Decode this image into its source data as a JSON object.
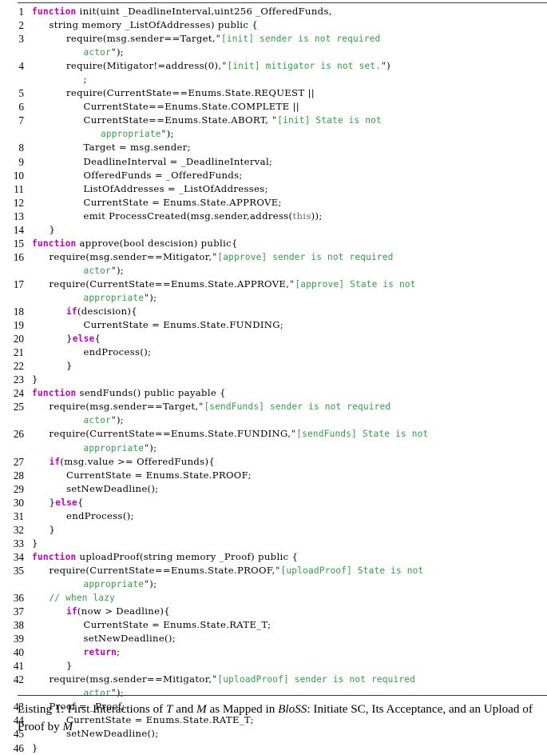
{
  "figure": {
    "type": "latex-code-listing",
    "language": "Solidity",
    "rules": {
      "color": "#3a3a3a"
    },
    "syntax_colors": {
      "keyword": "#bf00bf",
      "string": "#2f9e44",
      "comment": "#2f9e44",
      "identifier": "#000000",
      "builtin": "#6b6b6b",
      "background": "#ffffff"
    }
  },
  "caption": {
    "prefix": "Listing 1:",
    "text_part_1": " First Interactions of ",
    "em_1": "T",
    "text_part_2": " and ",
    "em_2": "M",
    "text_part_3": " as Mapped in ",
    "em_3": "BloSS",
    "text_part_4": ": Initiate SC, Its Acceptance, and an Upload of Proof by ",
    "em_4": "M",
    "full": "Listing 1: First Interactions of T and M as Mapped in BloSS: Initiate SC, Its Acceptance, and an Upload of Proof by M"
  },
  "code": {
    "line_numbers": [
      1,
      2,
      3,
      "",
      4,
      "",
      5,
      6,
      7,
      "",
      8,
      9,
      10,
      11,
      12,
      13,
      14,
      15,
      16,
      "",
      17,
      "",
      18,
      19,
      20,
      21,
      22,
      23,
      24,
      25,
      "",
      26,
      "",
      27,
      28,
      29,
      30,
      31,
      32,
      33,
      34,
      35,
      "",
      36,
      37,
      38,
      39,
      40,
      41,
      42,
      "",
      43,
      44,
      45,
      46
    ],
    "lines": [
      {
        "n": "1",
        "tokens": [
          {
            "t": "kw",
            "v": "function"
          },
          {
            "t": "id",
            "v": " init(uint _DeadlineInterval,uint256 _OfferedFunds,"
          }
        ],
        "indent": 0
      },
      {
        "n": "2",
        "tokens": [
          {
            "t": "id",
            "v": "string memory _ListOfAddresses) public {"
          }
        ],
        "indent": 1
      },
      {
        "n": "3",
        "tokens": [
          {
            "t": "id",
            "v": "require(msg.sender==Target,"
          },
          {
            "t": "qt",
            "v": "\""
          },
          {
            "t": "str",
            "v": "[init] sender is not required"
          }
        ],
        "indent": 2
      },
      {
        "n": "",
        "tokens": [
          {
            "t": "str",
            "v": "actor"
          },
          {
            "t": "qt",
            "v": "\""
          },
          {
            "t": "id",
            "v": ");"
          }
        ],
        "indent": 3
      },
      {
        "n": "4",
        "tokens": [
          {
            "t": "id",
            "v": "require(Mitigator!=address(0),"
          },
          {
            "t": "qt",
            "v": "\""
          },
          {
            "t": "str",
            "v": "[init] mitigator is not set."
          },
          {
            "t": "qt",
            "v": "\""
          },
          {
            "t": "id",
            "v": ")"
          }
        ],
        "indent": 2
      },
      {
        "n": "",
        "tokens": [
          {
            "t": "id",
            "v": ";"
          }
        ],
        "indent": 3
      },
      {
        "n": "5",
        "tokens": [
          {
            "t": "id",
            "v": "require(CurrentState==Enums.State.REQUEST ||"
          }
        ],
        "indent": 2
      },
      {
        "n": "6",
        "tokens": [
          {
            "t": "id",
            "v": "CurrentState==Enums.State.COMPLETE ||"
          }
        ],
        "indent": 3
      },
      {
        "n": "7",
        "tokens": [
          {
            "t": "id",
            "v": "CurrentState==Enums.State.ABORT, "
          },
          {
            "t": "qt",
            "v": "\""
          },
          {
            "t": "str",
            "v": "[init] State is not"
          }
        ],
        "indent": 3
      },
      {
        "n": "",
        "tokens": [
          {
            "t": "str",
            "v": "appropriate"
          },
          {
            "t": "qt",
            "v": "\""
          },
          {
            "t": "id",
            "v": ");"
          }
        ],
        "indent": 4
      },
      {
        "n": "8",
        "tokens": [
          {
            "t": "id",
            "v": "Target = msg.sender;"
          }
        ],
        "indent": 3
      },
      {
        "n": "9",
        "tokens": [
          {
            "t": "id",
            "v": "DeadlineInterval = _DeadlineInterval;"
          }
        ],
        "indent": 3
      },
      {
        "n": "10",
        "tokens": [
          {
            "t": "id",
            "v": "OfferedFunds = _OfferedFunds;"
          }
        ],
        "indent": 3
      },
      {
        "n": "11",
        "tokens": [
          {
            "t": "id",
            "v": "ListOfAddresses = _ListOfAddresses;"
          }
        ],
        "indent": 3
      },
      {
        "n": "12",
        "tokens": [
          {
            "t": "id",
            "v": "CurrentState = Enums.State.APPROVE;"
          }
        ],
        "indent": 3
      },
      {
        "n": "13",
        "tokens": [
          {
            "t": "id",
            "v": "emit ProcessCreated(msg.sender,address("
          },
          {
            "t": "gry",
            "v": "this"
          },
          {
            "t": "id",
            "v": "));"
          }
        ],
        "indent": 3
      },
      {
        "n": "14",
        "tokens": [
          {
            "t": "id",
            "v": "}"
          }
        ],
        "indent": 1
      },
      {
        "n": "15",
        "tokens": [
          {
            "t": "kw",
            "v": "function"
          },
          {
            "t": "id",
            "v": " approve(bool descision) public{"
          }
        ],
        "indent": 0
      },
      {
        "n": "16",
        "tokens": [
          {
            "t": "id",
            "v": "require(msg.sender==Mitigator,"
          },
          {
            "t": "qt",
            "v": "\""
          },
          {
            "t": "str",
            "v": "[approve] sender is not required"
          }
        ],
        "indent": 1
      },
      {
        "n": "",
        "tokens": [
          {
            "t": "str",
            "v": "actor"
          },
          {
            "t": "qt",
            "v": "\""
          },
          {
            "t": "id",
            "v": ");"
          }
        ],
        "indent": 3
      },
      {
        "n": "17",
        "tokens": [
          {
            "t": "id",
            "v": "require(CurrentState==Enums.State.APPROVE,"
          },
          {
            "t": "qt",
            "v": "\""
          },
          {
            "t": "str",
            "v": "[approve] State is not"
          }
        ],
        "indent": 1
      },
      {
        "n": "",
        "tokens": [
          {
            "t": "str",
            "v": "appropriate"
          },
          {
            "t": "qt",
            "v": "\""
          },
          {
            "t": "id",
            "v": ");"
          }
        ],
        "indent": 3
      },
      {
        "n": "18",
        "tokens": [
          {
            "t": "kw",
            "v": "if"
          },
          {
            "t": "id",
            "v": "(descision){"
          }
        ],
        "indent": 2
      },
      {
        "n": "19",
        "tokens": [
          {
            "t": "id",
            "v": "CurrentState = Enums.State.FUNDING;"
          }
        ],
        "indent": 3
      },
      {
        "n": "20",
        "tokens": [
          {
            "t": "id",
            "v": "}"
          },
          {
            "t": "kw",
            "v": "else"
          },
          {
            "t": "id",
            "v": "{"
          }
        ],
        "indent": 2
      },
      {
        "n": "21",
        "tokens": [
          {
            "t": "id",
            "v": "endProcess();"
          }
        ],
        "indent": 3
      },
      {
        "n": "22",
        "tokens": [
          {
            "t": "id",
            "v": "}"
          }
        ],
        "indent": 2
      },
      {
        "n": "23",
        "tokens": [
          {
            "t": "id",
            "v": "}"
          }
        ],
        "indent": 0
      },
      {
        "n": "24",
        "tokens": [
          {
            "t": "kw",
            "v": "function"
          },
          {
            "t": "id",
            "v": " sendFunds() public payable {"
          }
        ],
        "indent": 0
      },
      {
        "n": "25",
        "tokens": [
          {
            "t": "id",
            "v": "require(msg.sender==Target,"
          },
          {
            "t": "qt",
            "v": "\""
          },
          {
            "t": "str",
            "v": "[sendFunds] sender is not required"
          }
        ],
        "indent": 1
      },
      {
        "n": "",
        "tokens": [
          {
            "t": "str",
            "v": "actor"
          },
          {
            "t": "qt",
            "v": "\""
          },
          {
            "t": "id",
            "v": ");"
          }
        ],
        "indent": 3
      },
      {
        "n": "26",
        "tokens": [
          {
            "t": "id",
            "v": "require(CurrentState==Enums.State.FUNDING,"
          },
          {
            "t": "qt",
            "v": "\""
          },
          {
            "t": "str",
            "v": "[sendFunds] State is not"
          }
        ],
        "indent": 1
      },
      {
        "n": "",
        "tokens": [
          {
            "t": "str",
            "v": "appropriate"
          },
          {
            "t": "qt",
            "v": "\""
          },
          {
            "t": "id",
            "v": ");"
          }
        ],
        "indent": 3
      },
      {
        "n": "27",
        "tokens": [
          {
            "t": "kw",
            "v": "if"
          },
          {
            "t": "id",
            "v": "(msg.value >= OfferedFunds){"
          }
        ],
        "indent": 1
      },
      {
        "n": "28",
        "tokens": [
          {
            "t": "id",
            "v": "CurrentState = Enums.State.PROOF;"
          }
        ],
        "indent": 2
      },
      {
        "n": "29",
        "tokens": [
          {
            "t": "id",
            "v": "setNewDeadline();"
          }
        ],
        "indent": 2
      },
      {
        "n": "30",
        "tokens": [
          {
            "t": "id",
            "v": "}"
          },
          {
            "t": "kw",
            "v": "else"
          },
          {
            "t": "id",
            "v": "{"
          }
        ],
        "indent": 1
      },
      {
        "n": "31",
        "tokens": [
          {
            "t": "id",
            "v": "endProcess();"
          }
        ],
        "indent": 2
      },
      {
        "n": "32",
        "tokens": [
          {
            "t": "id",
            "v": "}"
          }
        ],
        "indent": 1
      },
      {
        "n": "33",
        "tokens": [
          {
            "t": "id",
            "v": "}"
          }
        ],
        "indent": 0
      },
      {
        "n": "34",
        "tokens": [
          {
            "t": "kw",
            "v": "function"
          },
          {
            "t": "id",
            "v": " uploadProof(string memory _Proof) public {"
          }
        ],
        "indent": 0
      },
      {
        "n": "35",
        "tokens": [
          {
            "t": "id",
            "v": "require(CurrentState==Enums.State.PROOF,"
          },
          {
            "t": "qt",
            "v": "\""
          },
          {
            "t": "str",
            "v": "[uploadProof] State is not"
          }
        ],
        "indent": 1
      },
      {
        "n": "",
        "tokens": [
          {
            "t": "str",
            "v": "appropriate"
          },
          {
            "t": "qt",
            "v": "\""
          },
          {
            "t": "id",
            "v": ");"
          }
        ],
        "indent": 3
      },
      {
        "n": "36",
        "tokens": [
          {
            "t": "cmt",
            "v": "// when lazy"
          }
        ],
        "indent": 1
      },
      {
        "n": "37",
        "tokens": [
          {
            "t": "kw",
            "v": "if"
          },
          {
            "t": "id",
            "v": "(now > Deadline){"
          }
        ],
        "indent": 2
      },
      {
        "n": "38",
        "tokens": [
          {
            "t": "id",
            "v": "CurrentState = Enums.State.RATE_T;"
          }
        ],
        "indent": 3
      },
      {
        "n": "39",
        "tokens": [
          {
            "t": "id",
            "v": "setNewDeadline();"
          }
        ],
        "indent": 3
      },
      {
        "n": "40",
        "tokens": [
          {
            "t": "kw",
            "v": "return"
          },
          {
            "t": "id",
            "v": ";"
          }
        ],
        "indent": 3
      },
      {
        "n": "41",
        "tokens": [
          {
            "t": "id",
            "v": "}"
          }
        ],
        "indent": 2
      },
      {
        "n": "42",
        "tokens": [
          {
            "t": "id",
            "v": "require(msg.sender==Mitigator,"
          },
          {
            "t": "qt",
            "v": "\""
          },
          {
            "t": "str",
            "v": "[uploadProof] sender is not required"
          }
        ],
        "indent": 1
      },
      {
        "n": "",
        "tokens": [
          {
            "t": "str",
            "v": "actor"
          },
          {
            "t": "qt",
            "v": "\""
          },
          {
            "t": "id",
            "v": ");"
          }
        ],
        "indent": 3
      },
      {
        "n": "43",
        "tokens": [
          {
            "t": "id",
            "v": "Proof = _Proof;"
          }
        ],
        "indent": 1
      },
      {
        "n": "44",
        "tokens": [
          {
            "t": "id",
            "v": "CurrentState = Enums.State.RATE_T;"
          }
        ],
        "indent": 2
      },
      {
        "n": "45",
        "tokens": [
          {
            "t": "id",
            "v": "setNewDeadline();"
          }
        ],
        "indent": 2
      },
      {
        "n": "46",
        "tokens": [
          {
            "t": "id",
            "v": "}"
          }
        ],
        "indent": 0
      }
    ]
  }
}
